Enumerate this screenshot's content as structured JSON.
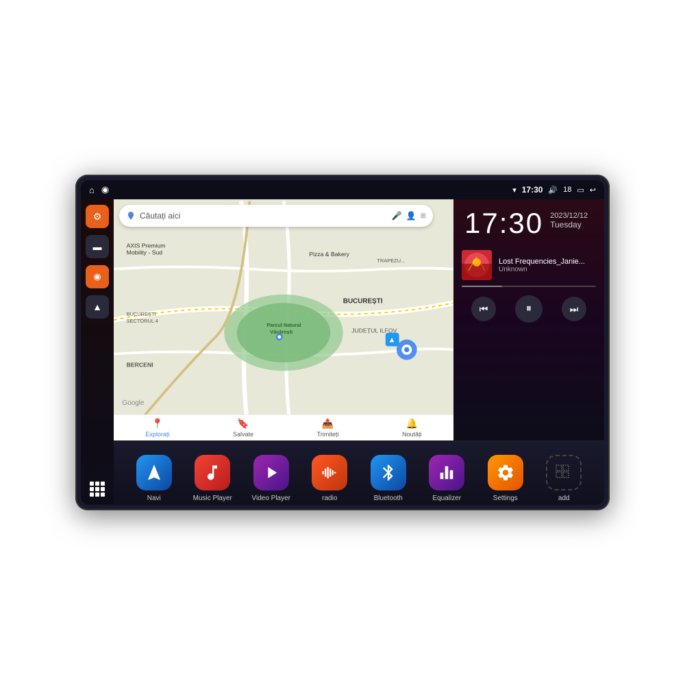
{
  "status_bar": {
    "left_icons": [
      "home",
      "location"
    ],
    "wifi": "▼",
    "time": "17:30",
    "volume_icon": "🔊",
    "battery_level": "18",
    "battery_icon": "▭",
    "back_icon": "↩"
  },
  "map": {
    "search_placeholder": "Căutați aici",
    "map_label_1": "AXIS Premium\nMobility - Sud",
    "map_label_2": "Pizza & Bakery",
    "map_label_3": "TRAPEZULUI",
    "map_label_4": "Parcul Natural Văcărești",
    "map_label_5": "BUCUREȘTI",
    "map_label_6": "SECTORUL 4",
    "map_label_7": "JUDEȚUL ILFOV",
    "map_label_8": "BERCENI",
    "nav_items": [
      {
        "label": "Explorați",
        "icon": "📍",
        "active": true
      },
      {
        "label": "Salvate",
        "icon": "🔖",
        "active": false
      },
      {
        "label": "Trimiteți",
        "icon": "📤",
        "active": false
      },
      {
        "label": "Noutăți",
        "icon": "🔔",
        "active": false
      }
    ]
  },
  "clock": {
    "time": "17:30",
    "date": "2023/12/12",
    "day": "Tuesday"
  },
  "music": {
    "title": "Lost Frequencies_Janie...",
    "artist": "Unknown",
    "controls": {
      "prev": "⏮",
      "play": "⏸",
      "next": "⏭"
    }
  },
  "apps": [
    {
      "id": "navi",
      "label": "Navi",
      "color_class": "icon-navi",
      "icon": "▲"
    },
    {
      "id": "music-player",
      "label": "Music Player",
      "color_class": "icon-music",
      "icon": "♫"
    },
    {
      "id": "video-player",
      "label": "Video Player",
      "color_class": "icon-video",
      "icon": "▶"
    },
    {
      "id": "radio",
      "label": "radio",
      "color_class": "icon-radio",
      "icon": "📻"
    },
    {
      "id": "bluetooth",
      "label": "Bluetooth",
      "color_class": "icon-bluetooth",
      "icon": "⦿"
    },
    {
      "id": "equalizer",
      "label": "Equalizer",
      "color_class": "icon-equalizer",
      "icon": "≡"
    },
    {
      "id": "settings",
      "label": "Settings",
      "color_class": "icon-settings",
      "icon": "⚙"
    },
    {
      "id": "add",
      "label": "add",
      "color_class": "icon-add",
      "icon": "+"
    }
  ],
  "sidebar": {
    "buttons": [
      {
        "id": "settings",
        "color": "orange",
        "icon": "⚙"
      },
      {
        "id": "folder",
        "color": "dark",
        "icon": "📁"
      },
      {
        "id": "map",
        "color": "orange",
        "icon": "📍"
      },
      {
        "id": "navi",
        "color": "dark",
        "icon": "▲"
      }
    ]
  }
}
